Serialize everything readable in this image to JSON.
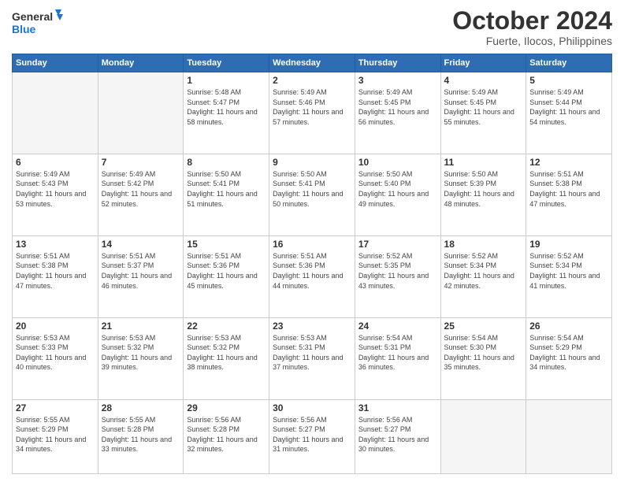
{
  "header": {
    "logo_line1": "General",
    "logo_line2": "Blue",
    "month": "October 2024",
    "location": "Fuerte, Ilocos, Philippines"
  },
  "weekdays": [
    "Sunday",
    "Monday",
    "Tuesday",
    "Wednesday",
    "Thursday",
    "Friday",
    "Saturday"
  ],
  "weeks": [
    [
      {
        "day": "",
        "sunrise": "",
        "sunset": "",
        "daylight": ""
      },
      {
        "day": "",
        "sunrise": "",
        "sunset": "",
        "daylight": ""
      },
      {
        "day": "1",
        "sunrise": "Sunrise: 5:48 AM",
        "sunset": "Sunset: 5:47 PM",
        "daylight": "Daylight: 11 hours and 58 minutes."
      },
      {
        "day": "2",
        "sunrise": "Sunrise: 5:49 AM",
        "sunset": "Sunset: 5:46 PM",
        "daylight": "Daylight: 11 hours and 57 minutes."
      },
      {
        "day": "3",
        "sunrise": "Sunrise: 5:49 AM",
        "sunset": "Sunset: 5:45 PM",
        "daylight": "Daylight: 11 hours and 56 minutes."
      },
      {
        "day": "4",
        "sunrise": "Sunrise: 5:49 AM",
        "sunset": "Sunset: 5:45 PM",
        "daylight": "Daylight: 11 hours and 55 minutes."
      },
      {
        "day": "5",
        "sunrise": "Sunrise: 5:49 AM",
        "sunset": "Sunset: 5:44 PM",
        "daylight": "Daylight: 11 hours and 54 minutes."
      }
    ],
    [
      {
        "day": "6",
        "sunrise": "Sunrise: 5:49 AM",
        "sunset": "Sunset: 5:43 PM",
        "daylight": "Daylight: 11 hours and 53 minutes."
      },
      {
        "day": "7",
        "sunrise": "Sunrise: 5:49 AM",
        "sunset": "Sunset: 5:42 PM",
        "daylight": "Daylight: 11 hours and 52 minutes."
      },
      {
        "day": "8",
        "sunrise": "Sunrise: 5:50 AM",
        "sunset": "Sunset: 5:41 PM",
        "daylight": "Daylight: 11 hours and 51 minutes."
      },
      {
        "day": "9",
        "sunrise": "Sunrise: 5:50 AM",
        "sunset": "Sunset: 5:41 PM",
        "daylight": "Daylight: 11 hours and 50 minutes."
      },
      {
        "day": "10",
        "sunrise": "Sunrise: 5:50 AM",
        "sunset": "Sunset: 5:40 PM",
        "daylight": "Daylight: 11 hours and 49 minutes."
      },
      {
        "day": "11",
        "sunrise": "Sunrise: 5:50 AM",
        "sunset": "Sunset: 5:39 PM",
        "daylight": "Daylight: 11 hours and 48 minutes."
      },
      {
        "day": "12",
        "sunrise": "Sunrise: 5:51 AM",
        "sunset": "Sunset: 5:38 PM",
        "daylight": "Daylight: 11 hours and 47 minutes."
      }
    ],
    [
      {
        "day": "13",
        "sunrise": "Sunrise: 5:51 AM",
        "sunset": "Sunset: 5:38 PM",
        "daylight": "Daylight: 11 hours and 47 minutes."
      },
      {
        "day": "14",
        "sunrise": "Sunrise: 5:51 AM",
        "sunset": "Sunset: 5:37 PM",
        "daylight": "Daylight: 11 hours and 46 minutes."
      },
      {
        "day": "15",
        "sunrise": "Sunrise: 5:51 AM",
        "sunset": "Sunset: 5:36 PM",
        "daylight": "Daylight: 11 hours and 45 minutes."
      },
      {
        "day": "16",
        "sunrise": "Sunrise: 5:51 AM",
        "sunset": "Sunset: 5:36 PM",
        "daylight": "Daylight: 11 hours and 44 minutes."
      },
      {
        "day": "17",
        "sunrise": "Sunrise: 5:52 AM",
        "sunset": "Sunset: 5:35 PM",
        "daylight": "Daylight: 11 hours and 43 minutes."
      },
      {
        "day": "18",
        "sunrise": "Sunrise: 5:52 AM",
        "sunset": "Sunset: 5:34 PM",
        "daylight": "Daylight: 11 hours and 42 minutes."
      },
      {
        "day": "19",
        "sunrise": "Sunrise: 5:52 AM",
        "sunset": "Sunset: 5:34 PM",
        "daylight": "Daylight: 11 hours and 41 minutes."
      }
    ],
    [
      {
        "day": "20",
        "sunrise": "Sunrise: 5:53 AM",
        "sunset": "Sunset: 5:33 PM",
        "daylight": "Daylight: 11 hours and 40 minutes."
      },
      {
        "day": "21",
        "sunrise": "Sunrise: 5:53 AM",
        "sunset": "Sunset: 5:32 PM",
        "daylight": "Daylight: 11 hours and 39 minutes."
      },
      {
        "day": "22",
        "sunrise": "Sunrise: 5:53 AM",
        "sunset": "Sunset: 5:32 PM",
        "daylight": "Daylight: 11 hours and 38 minutes."
      },
      {
        "day": "23",
        "sunrise": "Sunrise: 5:53 AM",
        "sunset": "Sunset: 5:31 PM",
        "daylight": "Daylight: 11 hours and 37 minutes."
      },
      {
        "day": "24",
        "sunrise": "Sunrise: 5:54 AM",
        "sunset": "Sunset: 5:31 PM",
        "daylight": "Daylight: 11 hours and 36 minutes."
      },
      {
        "day": "25",
        "sunrise": "Sunrise: 5:54 AM",
        "sunset": "Sunset: 5:30 PM",
        "daylight": "Daylight: 11 hours and 35 minutes."
      },
      {
        "day": "26",
        "sunrise": "Sunrise: 5:54 AM",
        "sunset": "Sunset: 5:29 PM",
        "daylight": "Daylight: 11 hours and 34 minutes."
      }
    ],
    [
      {
        "day": "27",
        "sunrise": "Sunrise: 5:55 AM",
        "sunset": "Sunset: 5:29 PM",
        "daylight": "Daylight: 11 hours and 34 minutes."
      },
      {
        "day": "28",
        "sunrise": "Sunrise: 5:55 AM",
        "sunset": "Sunset: 5:28 PM",
        "daylight": "Daylight: 11 hours and 33 minutes."
      },
      {
        "day": "29",
        "sunrise": "Sunrise: 5:56 AM",
        "sunset": "Sunset: 5:28 PM",
        "daylight": "Daylight: 11 hours and 32 minutes."
      },
      {
        "day": "30",
        "sunrise": "Sunrise: 5:56 AM",
        "sunset": "Sunset: 5:27 PM",
        "daylight": "Daylight: 11 hours and 31 minutes."
      },
      {
        "day": "31",
        "sunrise": "Sunrise: 5:56 AM",
        "sunset": "Sunset: 5:27 PM",
        "daylight": "Daylight: 11 hours and 30 minutes."
      },
      {
        "day": "",
        "sunrise": "",
        "sunset": "",
        "daylight": ""
      },
      {
        "day": "",
        "sunrise": "",
        "sunset": "",
        "daylight": ""
      }
    ]
  ]
}
